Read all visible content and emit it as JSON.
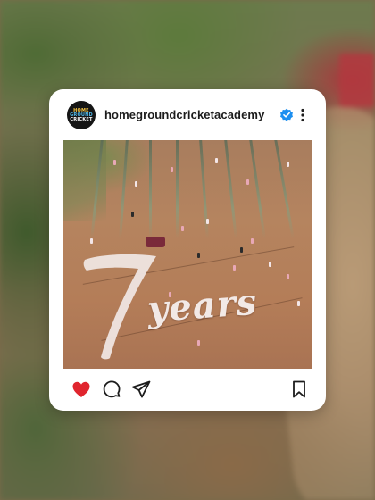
{
  "post": {
    "username": "homegroundcricketacademy",
    "verified": true,
    "image_text": {
      "number": "7",
      "word": "years"
    }
  },
  "avatar_logo": {
    "line1": "HOME",
    "line2": "GROUND",
    "line3": "CRICKET"
  },
  "icons": {
    "like": "heart-icon",
    "comment": "comment-icon",
    "share": "send-icon",
    "save": "bookmark-icon",
    "more": "more-vertical-icon",
    "verified": "verified-badge-icon"
  },
  "colors": {
    "like_red": "#e0252e",
    "verified_blue": "#1d8ff0",
    "card_bg": "#ffffff"
  }
}
